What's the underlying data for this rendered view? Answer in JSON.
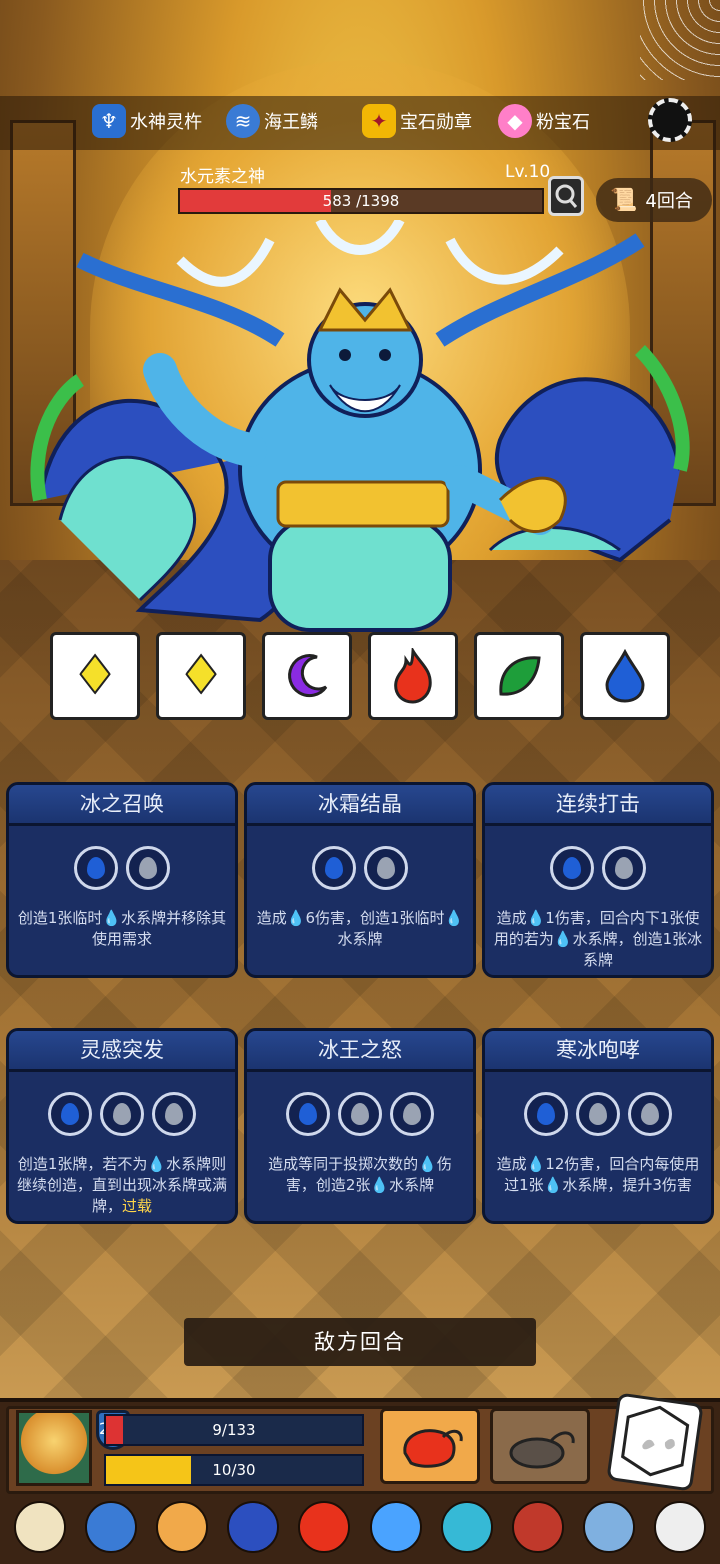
{
  "resources": [
    {
      "label": "水神灵杵",
      "icon": "trident-icon",
      "color": "#4aa3ff"
    },
    {
      "label": "海王鳞",
      "icon": "scale-icon",
      "color": "#3a7bd5"
    },
    {
      "label": "宝石勋章",
      "icon": "medal-icon",
      "color": "#f2b705"
    },
    {
      "label": "粉宝石",
      "icon": "pink-gem-icon",
      "color": "#ff7fc8"
    }
  ],
  "boss": {
    "name": "水元素之神",
    "level": "Lv.10",
    "hp_text": "583 /1398",
    "hp_fraction": 0.417
  },
  "turn_counter": "4回合",
  "dice": [
    {
      "symbol": "♦",
      "color": "#f5e02a",
      "icon": "yellow-diamond-icon"
    },
    {
      "symbol": "♦",
      "color": "#f5e02a",
      "icon": "yellow-diamond-icon"
    },
    {
      "symbol": "☾",
      "color": "#8a2be2",
      "icon": "purple-moon-icon"
    },
    {
      "symbol": "🔥",
      "color": "#e8321c",
      "icon": "red-fire-icon"
    },
    {
      "symbol": "❦",
      "color": "#1e9e3a",
      "icon": "green-leaf-icon"
    },
    {
      "symbol": "💧",
      "color": "#1f5fd6",
      "icon": "blue-water-icon"
    }
  ],
  "cards": [
    {
      "title": "冰之召唤",
      "slots": [
        "blue",
        "gray"
      ],
      "desc_a": "创造1张临时",
      "desc_b": "水系牌并移除其使用需求",
      "desc_c": ""
    },
    {
      "title": "冰霜结晶",
      "slots": [
        "blue",
        "gray"
      ],
      "desc_a": "造成",
      "desc_b": "6伤害，创造1张临时",
      "desc_c": "水系牌"
    },
    {
      "title": "连续打击",
      "slots": [
        "blue",
        "gray"
      ],
      "desc_a": "造成",
      "desc_b": "1伤害，回合内下1张使用的若为",
      "desc_c": "水系牌，创造1张冰系牌"
    },
    {
      "title": "灵感突发",
      "slots": [
        "blue",
        "gray",
        "gray"
      ],
      "desc_a": "创造1张牌，若不为",
      "desc_b": "水系牌则继续创造，直到出现冰系牌或满牌，",
      "desc_c": "过载"
    },
    {
      "title": "冰王之怒",
      "slots": [
        "blue",
        "gray",
        "gray"
      ],
      "desc_a": "造成等同于投掷次数的",
      "desc_b": "伤害，创造2张",
      "desc_c": "水系牌"
    },
    {
      "title": "寒冰咆哮",
      "slots": [
        "blue",
        "gray",
        "gray"
      ],
      "desc_a": "造成",
      "desc_b": "12伤害，回合内每使用过1张",
      "desc_c": "水系牌，提升3伤害"
    }
  ],
  "enemy_turn_label": "敌方回合",
  "player": {
    "shield": "237",
    "hp_text": "9/133",
    "hp_fraction": 0.068,
    "energy_text": "10/30",
    "energy_fraction": 0.333
  },
  "relics": [
    "mirror-icon",
    "mushroom-icon",
    "donut-icon",
    "viking-helmet-icon",
    "ruby-icon",
    "mask-icon",
    "crest-icon",
    "hood-icon",
    "wing-icon",
    "skull-icon"
  ],
  "colors": {
    "water": "#1f5fd6",
    "empty_slot": "#9aa3b3",
    "highlight": "#ffd54a"
  }
}
